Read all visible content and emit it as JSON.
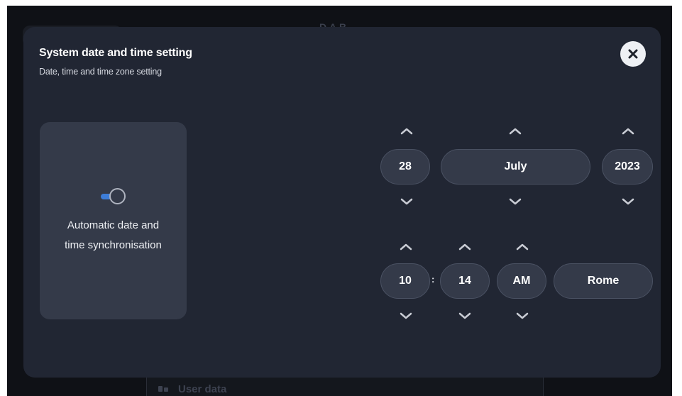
{
  "background": {
    "title": "D.A.B.",
    "user_data_label": "User data"
  },
  "modal": {
    "title": "System date and time setting",
    "subtitle": "Date, time and time zone setting",
    "close_icon": "close-icon"
  },
  "sync": {
    "label_line1": "Automatic date and",
    "label_line2": "time synchronisation",
    "enabled": true,
    "accent_color": "#3d7dd8"
  },
  "date": {
    "day": "28",
    "month": "July",
    "year": "2023"
  },
  "time": {
    "hour": "10",
    "separator": ":",
    "minute": "14",
    "period": "AM",
    "timezone": "Rome"
  },
  "icons": {
    "up": "chevron-up-icon",
    "down": "chevron-down-icon"
  }
}
